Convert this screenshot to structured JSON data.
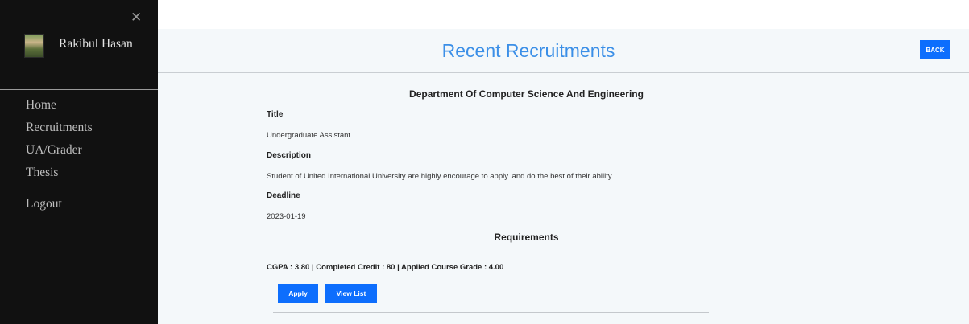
{
  "sidebar": {
    "close_icon": "close-icon",
    "user_name": "Rakibul Hasan",
    "nav": [
      {
        "label": "Home"
      },
      {
        "label": "Recruitments"
      },
      {
        "label": "UA/Grader"
      },
      {
        "label": "Thesis"
      },
      {
        "label": "Logout"
      }
    ]
  },
  "header": {
    "title": "Recent Recruitments",
    "back_label": "BACK"
  },
  "recruitment": {
    "department": "Department Of Computer Science And Engineering",
    "title_label": "Title",
    "title_value": "Undergraduate Assistant",
    "description_label": "Description",
    "description_value": "Student of United International University are highly encourage to apply. and do the best of their ability.",
    "deadline_label": "Deadline",
    "deadline_value": "2023-01-19",
    "requirements_heading": "Requirements",
    "requirements_value": "CGPA : 3.80 | Completed Credit : 80 | Applied Course Grade : 4.00",
    "apply_label": "Apply",
    "view_list_label": "View List"
  },
  "colors": {
    "sidebar_bg": "#111111",
    "accent": "#0d6efd",
    "title_color": "#3b8fe7",
    "content_bg": "#f4f8fa"
  }
}
